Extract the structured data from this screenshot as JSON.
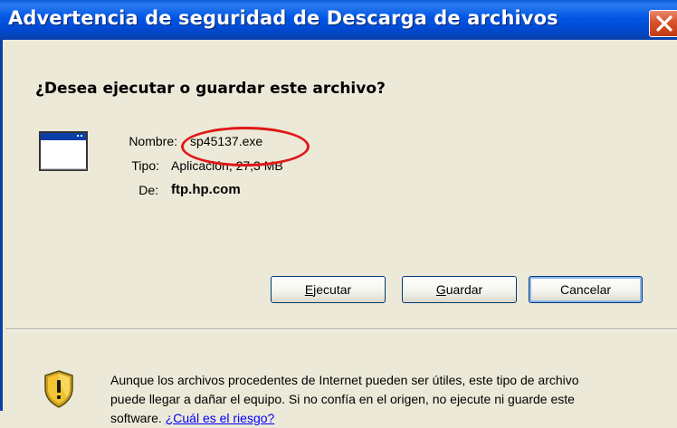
{
  "window": {
    "title": "Advertencia de seguridad de Descarga de archivos",
    "close_icon": "close-x-icon"
  },
  "dialog": {
    "question": "¿Desea ejecutar o guardar este archivo?",
    "file_icon": "application-window-icon",
    "fields": {
      "name_label": "Nombre:",
      "name_value": "sp45137.exe",
      "type_label": "Tipo:",
      "type_value": "Aplicación, 27,3 MB",
      "from_label": "De:",
      "from_value": "ftp.hp.com"
    },
    "buttons": {
      "run": {
        "mnemonic": "E",
        "rest": "jecutar"
      },
      "save": {
        "mnemonic": "G",
        "rest": "uardar"
      },
      "cancel": {
        "label": "Cancelar"
      }
    },
    "warning": {
      "icon": "security-shield-warning-icon",
      "text": "Aunque los archivos procedentes de Internet pueden ser útiles, este tipo de archivo puede llegar a dañar el equipo. Si no confía en el origen, no ejecute ni guarde este software. ",
      "link": "¿Cuál es el riesgo?"
    },
    "annotation_color": "#e01818"
  }
}
